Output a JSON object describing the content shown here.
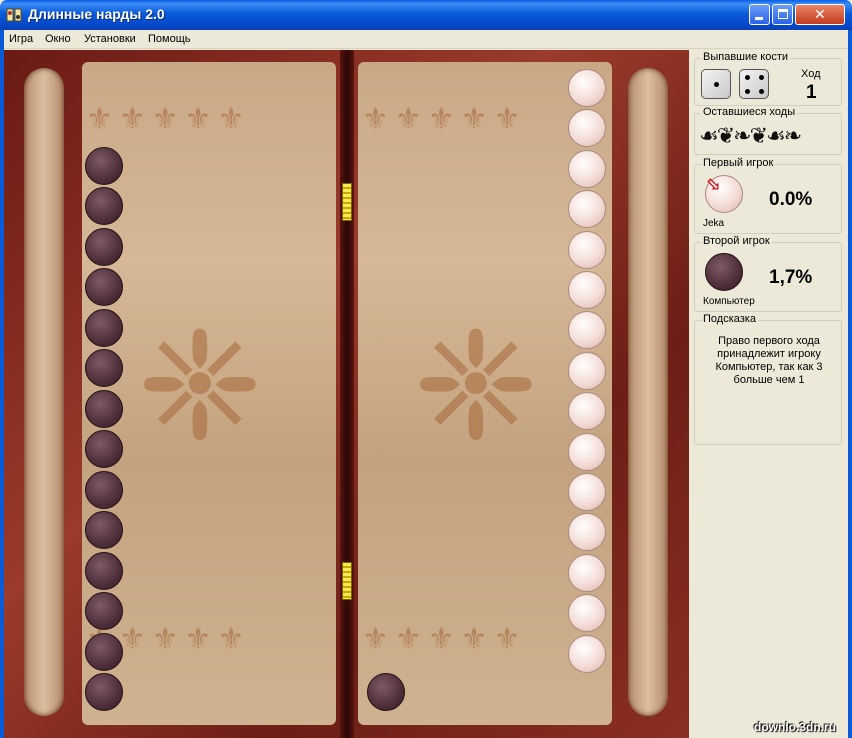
{
  "window": {
    "title": "Длинные нарды 2.0",
    "close_glyph": "✕"
  },
  "menu": [
    "Игра",
    "Окно",
    "Установки",
    "Помощь"
  ],
  "board": {
    "left_checkers_color": "dark",
    "left_checkers_count": 14,
    "right_checkers_color": "light",
    "right_checkers_count": 15,
    "extra_dark_checker_right": 1
  },
  "panel": {
    "dice": {
      "title": "Выпавшие кости",
      "die1": 1,
      "die2": 4,
      "move_label": "Ход",
      "move_value": "1"
    },
    "remaining": {
      "title": "Оставшиеся ходы",
      "ornament": "☙❦❧❦☙❧"
    },
    "player1": {
      "title": "Первый игрок",
      "name": "Jeka",
      "percent": "0.0%",
      "arrow": "⬂"
    },
    "player2": {
      "title": "Второй игрок",
      "name": "Компьютер",
      "percent": "1,7%"
    },
    "hint": {
      "title": "Подсказка",
      "text": "Право первого хода принадлежит игроку Компьютер, так как 3 больше чем 1"
    }
  },
  "watermark": "downlo.3dn.ru",
  "ornaments": {
    "big": "❈",
    "row": "⚜⚜⚜⚜⚜"
  }
}
